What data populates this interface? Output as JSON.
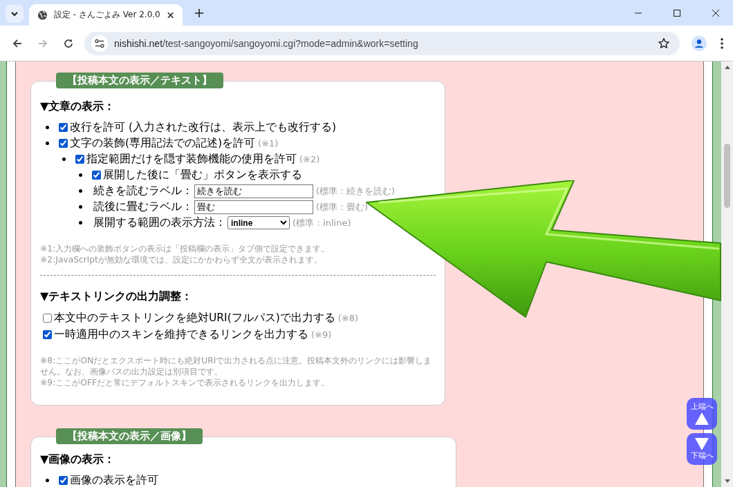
{
  "browser": {
    "tab_title": "設定 - さんごよみ Ver 2.0.0",
    "url_host": "nishishi.net",
    "url_path": "/test-sangoyomi/sangoyomi.cgi?mode=admin&work=setting",
    "forward_disabled": true
  },
  "sections": [
    {
      "title": "【投稿本文の表示／テキスト】",
      "blocks": [
        {
          "kind": "heading",
          "text": "▼文章の表示："
        },
        {
          "kind": "tree",
          "items": [
            {
              "kind": "checkbox",
              "label": "改行を許可 (入力された改行は、表示上でも改行する)",
              "checked": true
            },
            {
              "kind": "checkbox",
              "label": "文字の装飾(専用記法での記述)を許可",
              "note": "(※1)",
              "checked": true,
              "children": [
                {
                  "kind": "checkbox",
                  "label": "指定範囲だけを隠す装飾機能の使用を許可",
                  "note": "(※2)",
                  "checked": true,
                  "children": [
                    {
                      "kind": "checkbox",
                      "label": "展開した後に「畳む」ボタンを表示する",
                      "checked": true
                    },
                    {
                      "kind": "text",
                      "label": "続きを読むラベル：",
                      "value": "続きを読む",
                      "note": "(標準：続きを読む)"
                    },
                    {
                      "kind": "text",
                      "label": "読後に畳むラベル：",
                      "value": "畳む",
                      "note": "(標準：畳む)"
                    },
                    {
                      "kind": "select",
                      "label": "展開する範囲の表示方法：",
                      "value": "inline",
                      "note": "(標準：inline)"
                    }
                  ]
                }
              ]
            }
          ]
        },
        {
          "kind": "notes",
          "lines": [
            "※1:入力欄への装飾ボタンの表示は「投稿欄の表示」タブ側で設定できます。",
            "※2:JavaScriptが無効な環境では、設定にかかわらず全文が表示されます。"
          ]
        },
        {
          "kind": "divider"
        },
        {
          "kind": "heading",
          "text": "▼テキストリンクの出力調整："
        },
        {
          "kind": "checklist",
          "items": [
            {
              "label": "本文中のテキストリンクを絶対URI(フルパス)で出力する",
              "note": "(※8)",
              "checked": false
            },
            {
              "label": "一時適用中のスキンを維持できるリンクを出力する",
              "note": "(※9)",
              "checked": true
            }
          ]
        },
        {
          "kind": "notes",
          "lines": [
            "※8:ここがONだとエクスポート時にも絶対URIで出力される点に注意。投稿本文外のリンクには影響しません。なお、画像パスの出力設定は別項目です。",
            "※9:ここがOFFだと常にデフォルトスキンで表示されるリンクを出力します。"
          ]
        }
      ]
    },
    {
      "title": "【投稿本文の表示／画像】",
      "blocks": [
        {
          "kind": "heading",
          "text": "▼画像の表示："
        },
        {
          "kind": "tree",
          "items": [
            {
              "kind": "checkbox",
              "label": "画像の表示を許可",
              "checked": true
            }
          ]
        }
      ]
    }
  ],
  "jump_buttons": [
    {
      "kind": "up",
      "label": "上端へ"
    },
    {
      "kind": "down",
      "label": "下端へ"
    }
  ]
}
